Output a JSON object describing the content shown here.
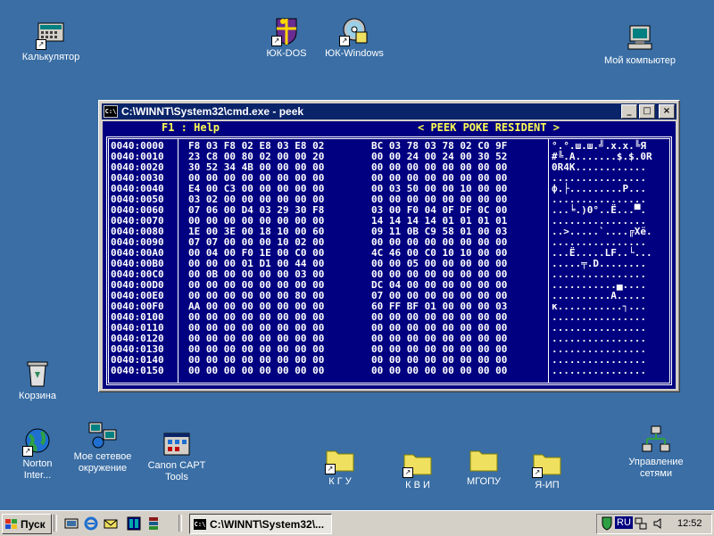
{
  "desktop": {
    "icons": [
      {
        "label": "Калькулятор"
      },
      {
        "label": "ЮК-DOS"
      },
      {
        "label": "ЮК-Windows"
      },
      {
        "label": "Мой компьютер"
      },
      {
        "label": "Корзина"
      },
      {
        "label": "Norton Inter..."
      },
      {
        "label": "Мое сетевое окружение"
      },
      {
        "label": "Canon CAPT Tools"
      },
      {
        "label": "К Г У"
      },
      {
        "label": "К В И"
      },
      {
        "label": "МГОПУ"
      },
      {
        "label": "Я-ИП"
      },
      {
        "label": "Управление сетями"
      }
    ]
  },
  "window": {
    "title": "C:\\WINNT\\System32\\cmd.exe - peek",
    "minimize": "_",
    "maximize": "□",
    "close": "×",
    "icon_text": "C:\\"
  },
  "console": {
    "help": "F1 : Help",
    "banner": "< PEEK POKE RESIDENT >",
    "addresses": [
      "0040:0000",
      "0040:0010",
      "0040:0020",
      "0040:0030",
      "0040:0040",
      "0040:0050",
      "0040:0060",
      "0040:0070",
      "0040:0080",
      "0040:0090",
      "0040:00A0",
      "0040:00B0",
      "0040:00C0",
      "0040:00D0",
      "0040:00E0",
      "0040:00F0",
      "0040:0100",
      "0040:0110",
      "0040:0120",
      "0040:0130",
      "0040:0140",
      "0040:0150"
    ],
    "hex_left": [
      "F8 03 F8 02 E8 03 E8 02",
      "23 C8 00 80 02 00 00 20",
      "30 52 34 4B 00 00 00 00",
      "00 00 00 00 00 00 00 00",
      "E4 00 C3 00 00 00 00 00",
      "03 02 00 00 00 00 00 00",
      "07 06 00 D4 03 29 30 F8",
      "00 00 00 00 00 00 00 00",
      "1E 00 3E 00 18 10 00 60",
      "07 07 00 00 00 10 02 00",
      "00 04 00 F0 1E 00 C0 00",
      "00 00 00 01 D1 00 44 00",
      "00 0B 00 00 00 00 03 00",
      "00 00 00 00 00 00 00 00",
      "00 00 00 00 00 00 80 00",
      "AA 00 00 00 00 00 00 00",
      "00 00 00 00 00 00 00 00",
      "00 00 00 00 00 00 00 00",
      "00 00 00 00 00 00 00 00",
      "00 00 00 00 00 00 00 00",
      "00 00 00 00 00 00 00 00",
      "00 00 00 00 00 00 00 00"
    ],
    "hex_right": [
      "BC 03 78 03 78 02 C0 9F",
      "00 00 24 00 24 00 30 52",
      "00 00 00 00 00 00 00 00",
      "00 00 00 00 00 00 00 00",
      "00 03 50 00 00 10 00 00",
      "00 00 00 00 00 00 00 00",
      "03 00 F0 04 0F DF 0C 00",
      "14 14 14 14 01 01 01 01",
      "09 11 0B C9 58 01 00 03",
      "00 00 00 00 00 00 00 00",
      "4C 46 00 C0 10 10 00 00",
      "00 00 05 00 00 00 00 00",
      "00 00 00 00 00 00 00 00",
      "DC 04 00 00 00 00 00 00",
      "07 00 00 00 00 00 00 00",
      "60 FF BF 01 00 00 00 03",
      "00 00 00 00 00 00 00 00",
      "00 00 00 00 00 00 00 00",
      "00 00 00 00 00 00 00 00",
      "00 00 00 00 00 00 00 00",
      "00 00 00 00 00 00 00 00",
      "00 00 00 00 00 00 00 00"
    ],
    "ascii": [
      "°.°.ш.ш.╝.x.x.╚Я",
      "#╚.А.......$.$.0R",
      "0R4K............",
      "................",
      "ф.├.........P...",
      "................",
      "...╘.)0°..Ё...▀.",
      "................",
      "..>.....`....╔Xё.",
      "................",
      "...Ё.....LF..└...",
      ".....╤.D........",
      "................",
      "...........▄....",
      "..........А.....",
      "к...........┐...",
      "................",
      "................",
      "................",
      "................",
      "................",
      "................"
    ]
  },
  "taskbar": {
    "start_label": "Пуск",
    "task_title": "C:\\WINNT\\System32\\...",
    "lang": "RU",
    "clock": "12:52"
  }
}
